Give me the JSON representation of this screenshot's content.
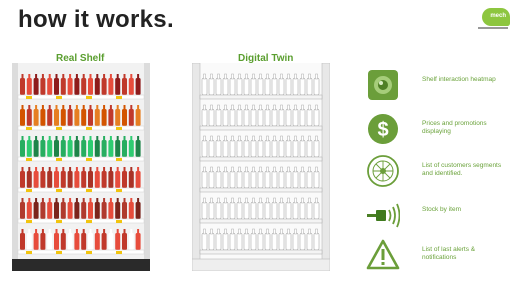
{
  "header": {
    "title": "how it works."
  },
  "logo": {
    "text": "mech"
  },
  "real_shelf": {
    "title": "Real Shelf"
  },
  "digital_twin": {
    "title": "Digital Twin"
  },
  "features": [
    {
      "icon": "heatmap-icon",
      "label": "Shelf interaction heatmap"
    },
    {
      "icon": "dollar-icon",
      "label": "Prices and promotions displaying"
    },
    {
      "icon": "segments-icon",
      "label": "List of customers segments and identified."
    },
    {
      "icon": "stock-signal-icon",
      "label": "Stock by item"
    },
    {
      "icon": "alert-icon",
      "label": "List of last alerts & notifications"
    }
  ],
  "colors": {
    "accent": "#6aa23a",
    "icon_bg": "#6b9e3a",
    "brand": "#8dc63f"
  }
}
